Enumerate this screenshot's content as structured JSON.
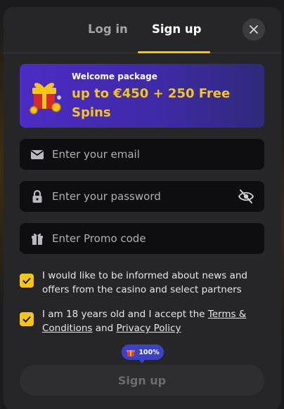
{
  "tabs": {
    "login": "Log in",
    "signup": "Sign up",
    "active": "Sign up"
  },
  "banner": {
    "kicker": "Welcome package",
    "headline": "up to €450 + 250 Free Spins"
  },
  "form": {
    "email_placeholder": "Enter your email",
    "password_placeholder": "Enter your password",
    "promo_placeholder": "Enter Promo code"
  },
  "consents": {
    "news": {
      "text": "I would like to be informed about news and offers from the casino and select partners",
      "checked": true
    },
    "age": {
      "prefix": "I am 18 years old and I accept the ",
      "terms_link": "Terms & Conditions",
      "middle": " and ",
      "privacy_link": "Privacy Policy",
      "checked": true
    }
  },
  "progress_badge": {
    "label": "100%",
    "value": 100
  },
  "submit": {
    "label": "Sign up",
    "enabled": false
  },
  "colors": {
    "accent": "#f5c518",
    "banner": "#4b2cc4",
    "field_bg": "#0e0e10",
    "badge": "#3b43c4"
  },
  "icons": [
    "close-icon",
    "gift-icon",
    "mail-icon",
    "lock-icon",
    "eye-off-icon",
    "promo-gift-icon",
    "checkmark-icon"
  ]
}
